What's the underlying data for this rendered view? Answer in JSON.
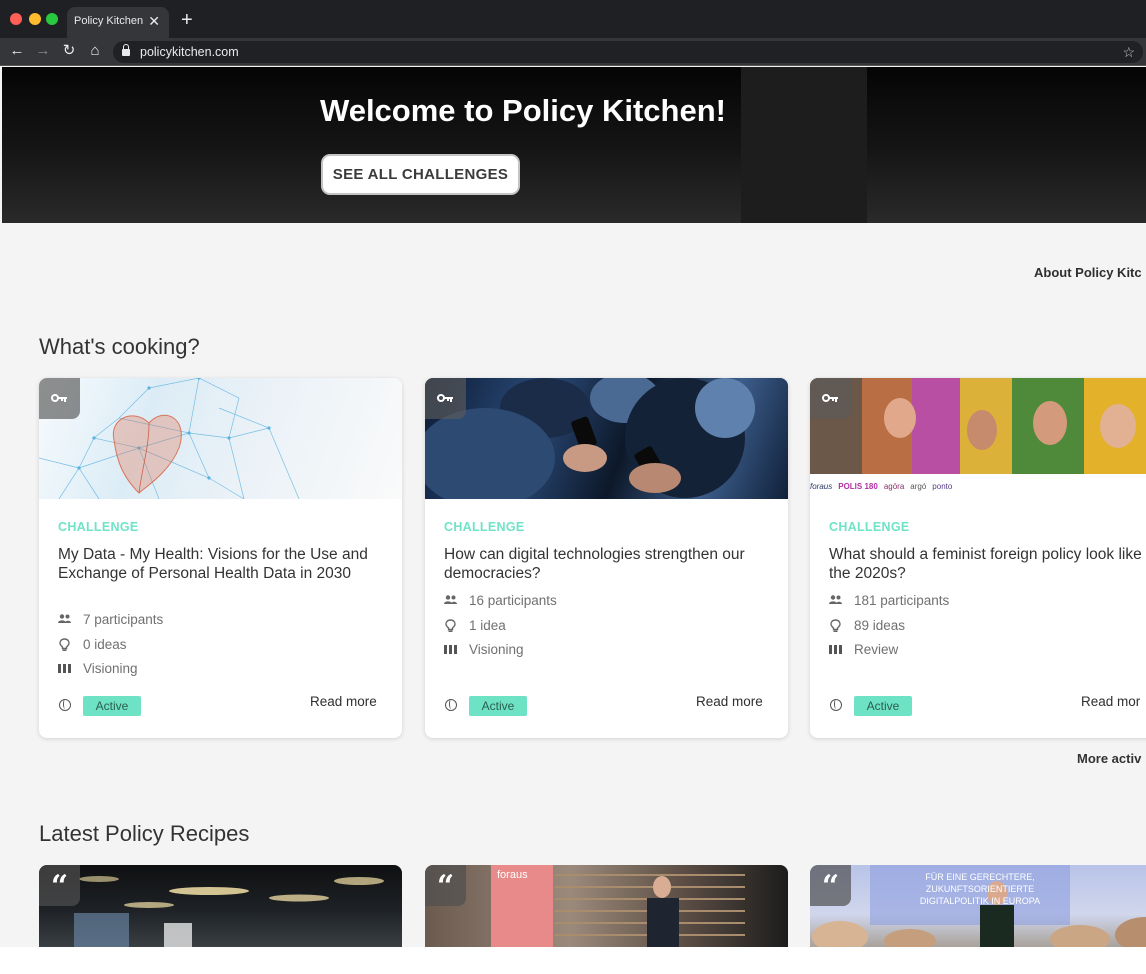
{
  "browser": {
    "tab_title": "Policy Kitchen",
    "url": "policykitchen.com"
  },
  "hero": {
    "title": "Welcome to Policy Kitchen!",
    "cta_label": "SEE ALL CHALLENGES"
  },
  "about_link": "About Policy Kitc",
  "whats_cooking": {
    "title": "What's cooking?",
    "more_link": "More activ",
    "cards": [
      {
        "label": "CHALLENGE",
        "title": "My Data - My Health: Visions for the Use and Exchange of Personal Health Data in 2030",
        "participants": "7 participants",
        "ideas": "0 ideas",
        "phase": "Visioning",
        "status": "Active",
        "read_more": "Read more"
      },
      {
        "label": "CHALLENGE",
        "title": "How can digital technologies strengthen our democracies?",
        "participants": "16 participants",
        "ideas": "1 idea",
        "phase": "Visioning",
        "status": "Active",
        "read_more": "Read more"
      },
      {
        "label": "CHALLENGE",
        "title": "What should a feminist foreign policy look like in the 2020s?",
        "participants": "181 participants",
        "ideas": "89 ideas",
        "phase": "Review",
        "status": "Active",
        "read_more": "Read mor",
        "partner_logos": [
          "foraus",
          "POLIS 180",
          "agöra",
          "argó",
          "ponto"
        ]
      }
    ]
  },
  "latest_recipes": {
    "title": "Latest Policy Recipes",
    "cards": [
      {
        "image_text": []
      },
      {
        "image_text": [
          "foraus"
        ]
      },
      {
        "image_text": [
          "Für eine gerechtere,",
          "zukunftsorientierte",
          "Digitalpolitik in Europa"
        ]
      }
    ]
  },
  "colors": {
    "accent_teal": "#6fe3c7",
    "badge_teal": "#6de2c4",
    "hero_bg": "#0d0d0d",
    "page_bg": "#f4f4f4"
  }
}
